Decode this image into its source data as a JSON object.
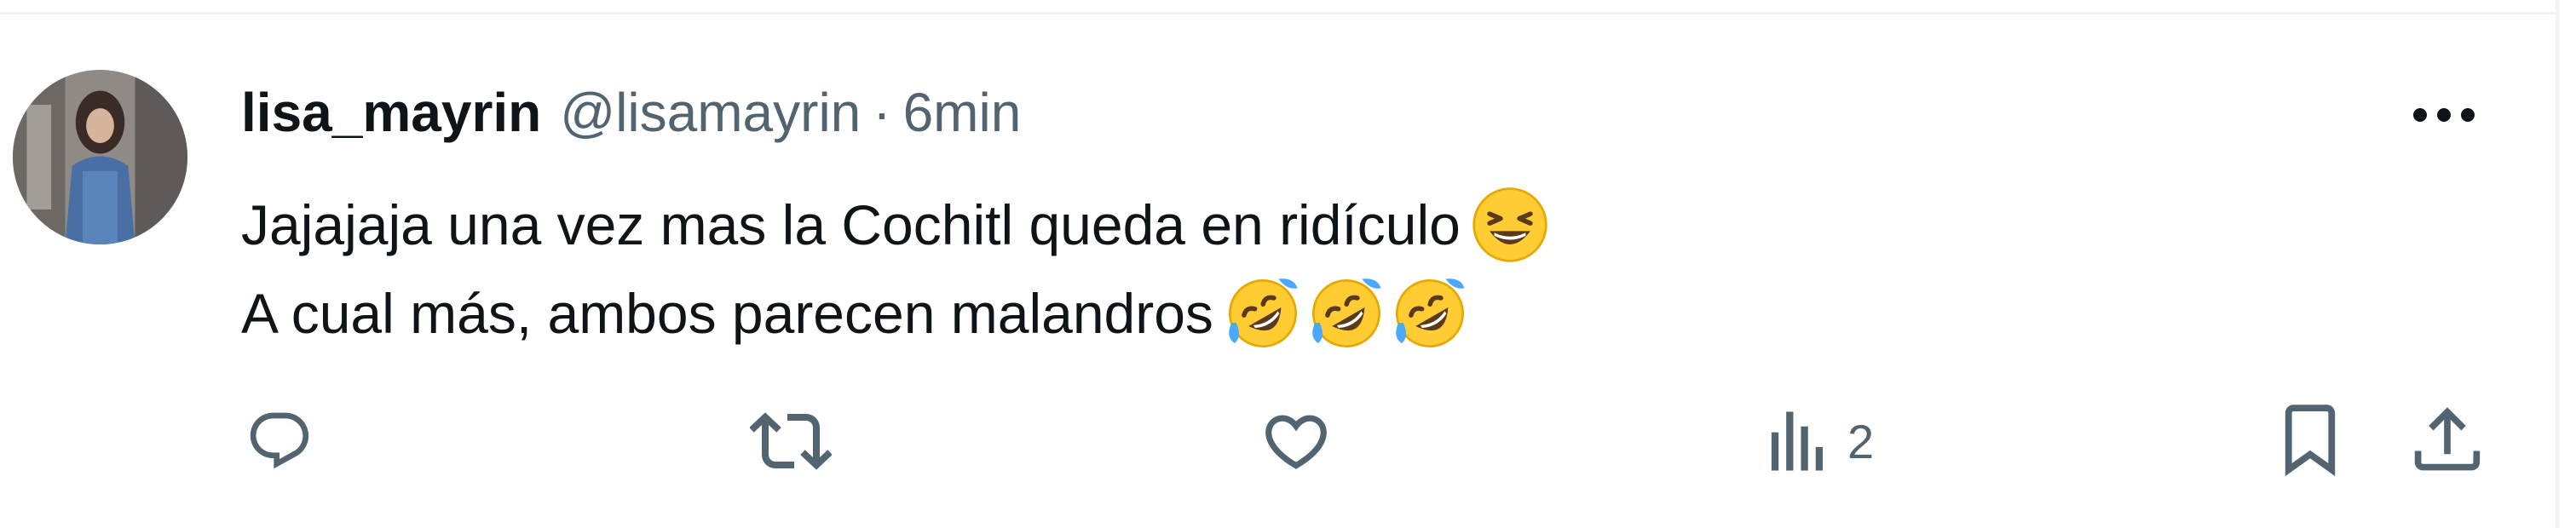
{
  "tweet": {
    "display_name": "lisa_mayrin",
    "handle": "@lisamayrin",
    "separator": "·",
    "timestamp": "6min",
    "lines": [
      "Jajajaja una vez mas la Cochitl queda en ridículo",
      "A cual más, ambos parecen malandros"
    ],
    "emojis_line1": [
      "grinning-squinting-face"
    ],
    "emojis_line2": [
      "rolling-on-floor-laughing",
      "rolling-on-floor-laughing",
      "rolling-on-floor-laughing"
    ]
  },
  "actions": {
    "views_count": "2",
    "icons": [
      "reply-icon",
      "retweet-icon",
      "like-icon",
      "views-icon",
      "bookmark-icon",
      "share-icon"
    ]
  },
  "colors": {
    "text_primary": "#0f1419",
    "text_secondary": "#536471",
    "divider": "#eff3f4",
    "emoji_yellow": "#ffcc33",
    "emoji_tear": "#4aa8ff"
  }
}
